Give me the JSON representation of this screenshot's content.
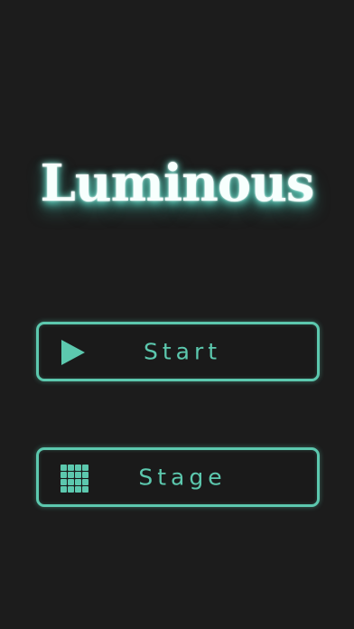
{
  "title": "Luminous",
  "menu": {
    "start": {
      "label": "Start",
      "icon": "play-icon"
    },
    "stage": {
      "label": "Stage",
      "icon": "grid-icon"
    }
  },
  "colors": {
    "background": "#1c1c1c",
    "accent": "#5cc8ae",
    "title_text": "#f7fffd",
    "title_glow": "#5adcc8"
  }
}
